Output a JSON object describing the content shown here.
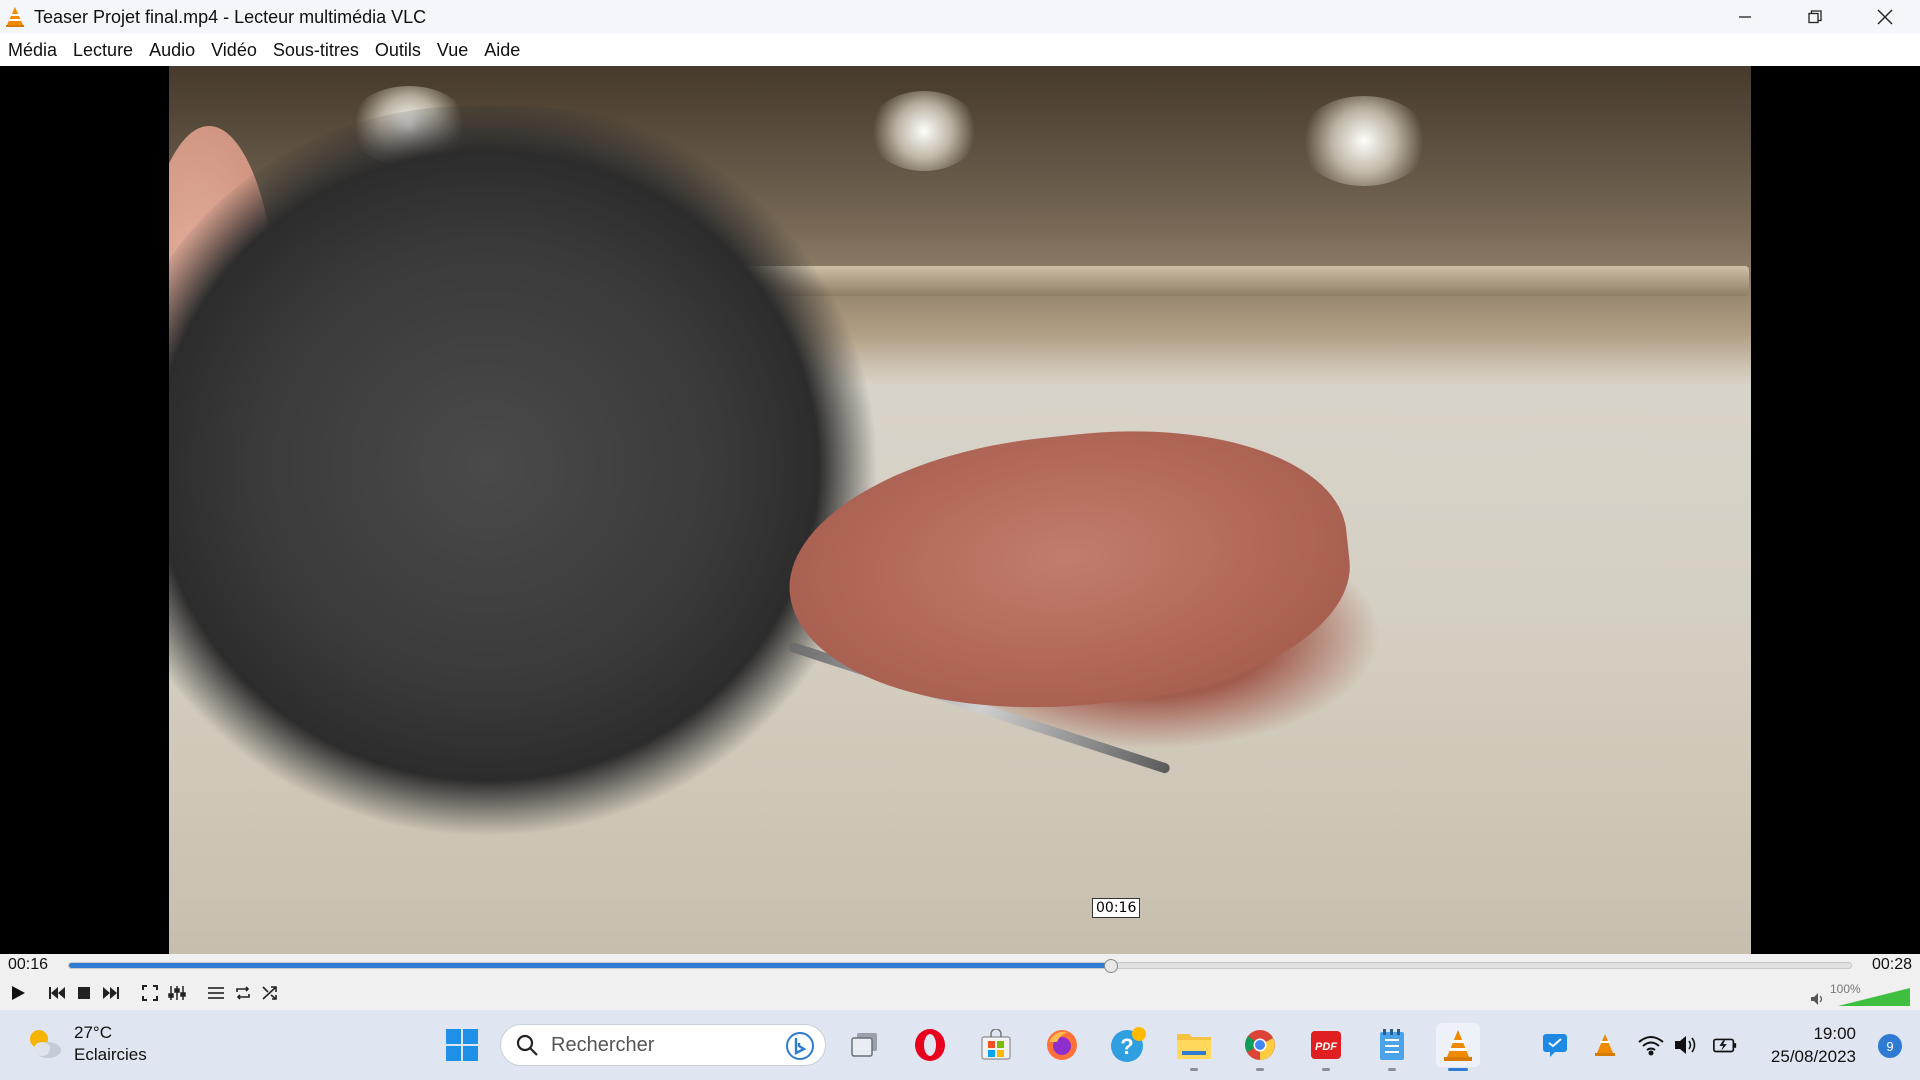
{
  "window": {
    "title": "Teaser Projet final.mp4 - Lecteur multimédia VLC",
    "controls": [
      "minimize",
      "restore",
      "close"
    ]
  },
  "menu": {
    "items": [
      "Média",
      "Lecture",
      "Audio",
      "Vidéo",
      "Sous-titres",
      "Outils",
      "Vue",
      "Aide"
    ]
  },
  "player": {
    "current_time": "00:16",
    "total_time": "00:28",
    "seek_tooltip": "00:16",
    "progress_fraction": 0.585,
    "volume_label": "100%",
    "volume_level": 1.0
  },
  "controls": {
    "buttons": [
      "play-icon",
      "previous-icon",
      "stop-icon",
      "next-icon",
      "fullscreen-icon",
      "extended-settings-icon",
      "playlist-icon",
      "loop-icon",
      "shuffle-icon"
    ]
  },
  "taskbar": {
    "weather": {
      "temp": "27°C",
      "condition": "Eclaircies"
    },
    "search_placeholder": "Rechercher",
    "apps": [
      "windows-start-icon",
      "task-view-icon",
      "opera-icon",
      "microsoft-store-icon",
      "firefox-icon",
      "help-icon",
      "file-explorer-icon",
      "chrome-icon",
      "pdf-icon",
      "notepad-icon",
      "vlc-icon"
    ],
    "clock": {
      "time": "19:00",
      "date": "25/08/2023"
    },
    "notifications": "9"
  },
  "colors": {
    "accent": "#2f7bd3",
    "vlc_orange": "#f08a00",
    "volume_green": "#3fbf3f"
  }
}
